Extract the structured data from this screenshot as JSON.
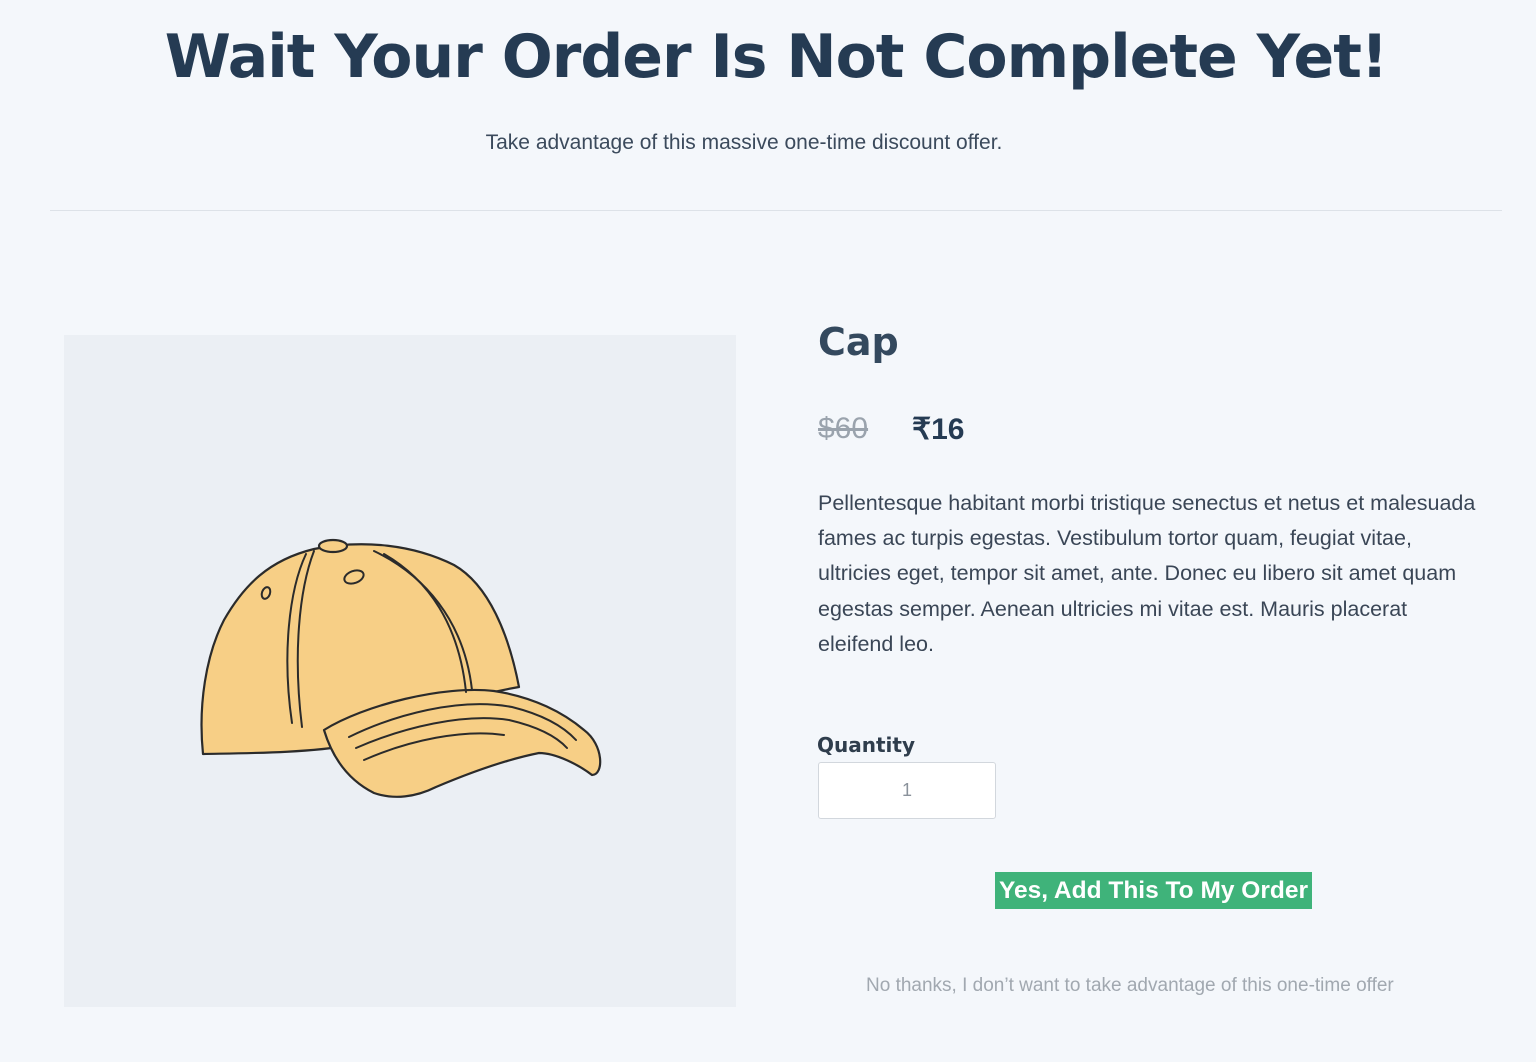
{
  "header": {
    "title": "Wait Your Order Is Not Complete Yet!",
    "subtitle": "Take advantage of this massive one-time discount offer."
  },
  "product": {
    "name": "Cap",
    "price_original": "$60",
    "price_offer": "₹16",
    "description": "Pellentesque habitant morbi tristique senectus et netus et malesuada fames ac turpis egestas. Vestibulum tortor quam, feugiat vitae, ultricies eget, tempor sit amet, ante. Donec eu libero sit amet quam egestas semper. Aenean ultricies mi vitae est. Mauris placerat eleifend leo.",
    "image_icon": "cap-illustration"
  },
  "quantity": {
    "label": "Quantity",
    "value": "1"
  },
  "actions": {
    "accept_label": "Yes, Add This To My Order",
    "decline_label": "No thanks, I don’t want to take advantage of this one-time offer"
  },
  "colors": {
    "background": "#f4f7fb",
    "accent": "#3fb37a",
    "heading": "#253b53",
    "cap_fill": "#f7cf86"
  }
}
